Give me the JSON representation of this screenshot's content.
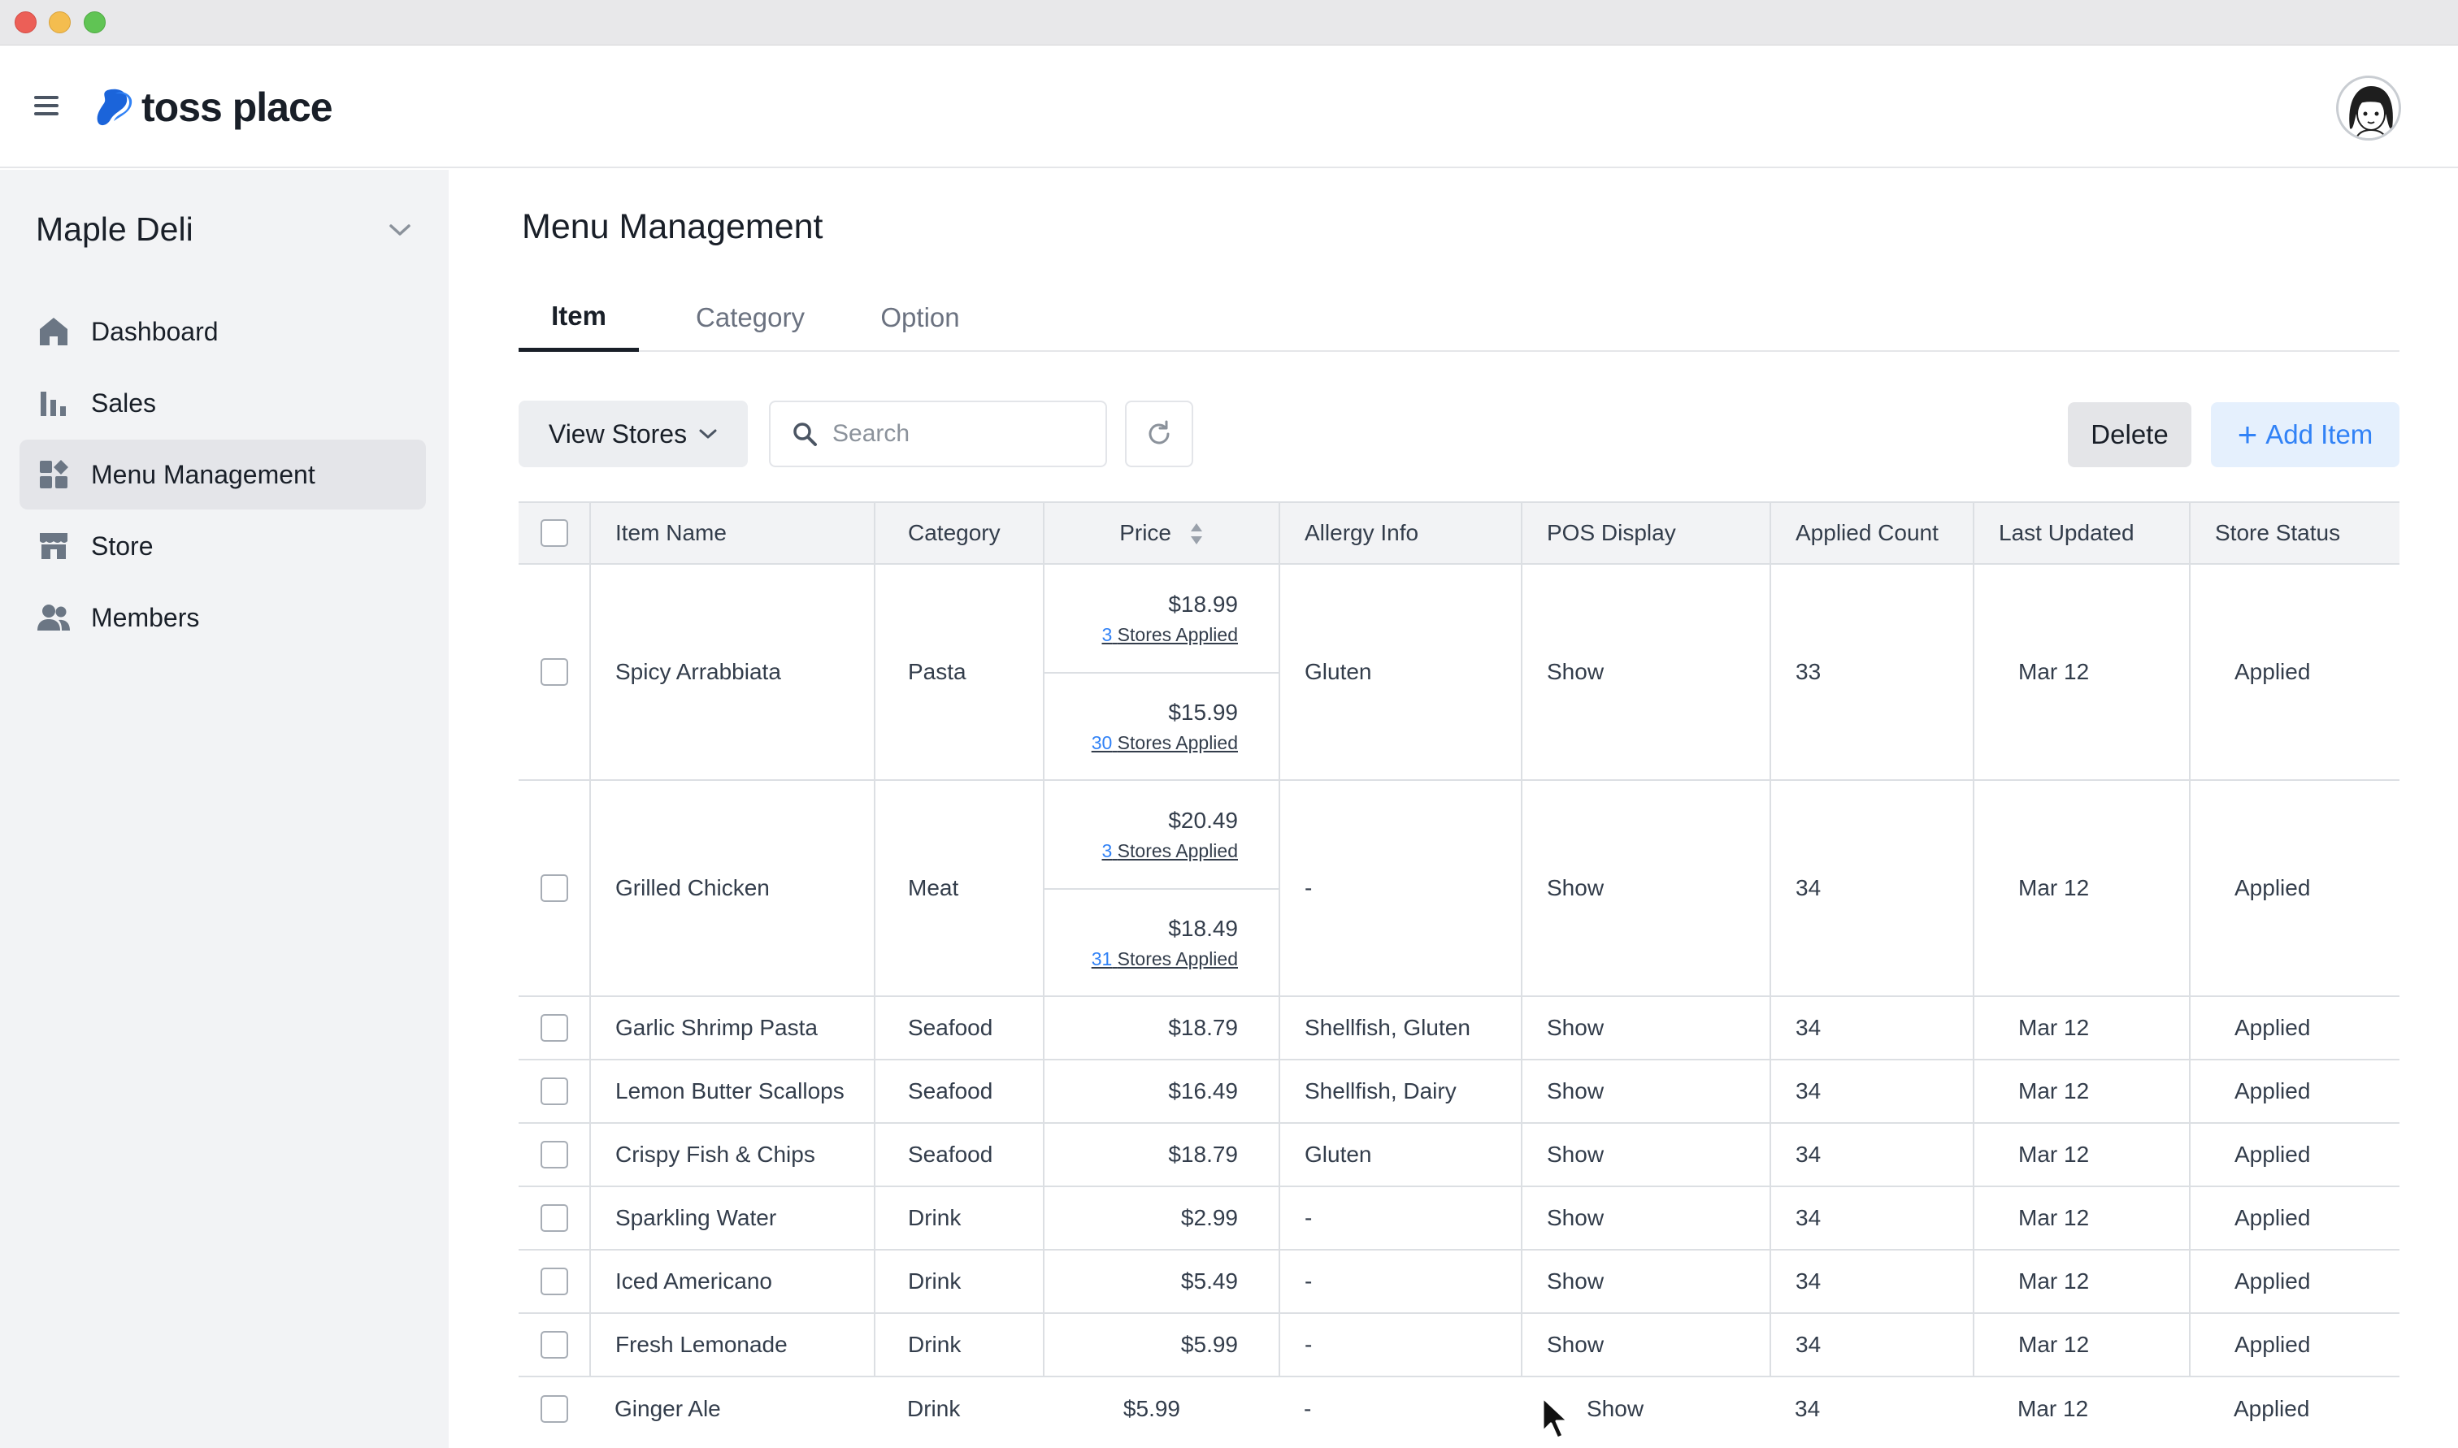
{
  "app": {
    "logo_text": "toss place",
    "brand_color": "#3182f6"
  },
  "sidebar": {
    "store_name": "Maple Deli",
    "items": [
      {
        "label": "Dashboard",
        "icon": "home-icon"
      },
      {
        "label": "Sales",
        "icon": "bar-chart-icon"
      },
      {
        "label": "Menu Management",
        "icon": "grid-icon",
        "active": true
      },
      {
        "label": "Store",
        "icon": "storefront-icon"
      },
      {
        "label": "Members",
        "icon": "people-icon"
      }
    ]
  },
  "main": {
    "title": "Menu Management",
    "tabs": [
      "Item",
      "Category",
      "Option"
    ],
    "active_tab": "Item",
    "toolbar": {
      "view_stores": "View Stores",
      "search_placeholder": "Search",
      "delete": "Delete",
      "add_item": "Add Item"
    },
    "table": {
      "columns": [
        "Item Name",
        "Category",
        "Price",
        "Allergy Info",
        "POS Display",
        "Applied Count",
        "Last Updated",
        "Store Status"
      ],
      "rows": [
        {
          "name": "Spicy Arrabbiata",
          "category": "Pasta",
          "prices": [
            {
              "value": "$18.99",
              "count": "3",
              "stores": "Stores Applied"
            },
            {
              "value": "$15.99",
              "count": "30",
              "stores": "Stores Applied"
            }
          ],
          "allergy": "Gluten",
          "pos": "Show",
          "applied": "33",
          "updated": "Mar 12",
          "status": "Applied"
        },
        {
          "name": "Grilled Chicken",
          "category": "Meat",
          "prices": [
            {
              "value": "$20.49",
              "count": "3",
              "stores": "Stores Applied"
            },
            {
              "value": "$18.49",
              "count": "31",
              "stores": "Stores Applied"
            }
          ],
          "allergy": "-",
          "pos": "Show",
          "applied": "34",
          "updated": "Mar 12",
          "status": "Applied"
        },
        {
          "name": "Garlic Shrimp Pasta",
          "category": "Seafood",
          "price": "$18.79",
          "allergy": "Shellfish, Gluten",
          "pos": "Show",
          "applied": "34",
          "updated": "Mar 12",
          "status": "Applied"
        },
        {
          "name": "Lemon Butter Scallops",
          "category": "Seafood",
          "price": "$16.49",
          "allergy": "Shellfish, Dairy",
          "pos": "Show",
          "applied": "34",
          "updated": "Mar 12",
          "status": "Applied"
        },
        {
          "name": "Crispy Fish & Chips",
          "category": "Seafood",
          "price": "$18.79",
          "allergy": "Gluten",
          "pos": "Show",
          "applied": "34",
          "updated": "Mar 12",
          "status": "Applied"
        },
        {
          "name": "Sparkling Water",
          "category": "Drink",
          "price": "$2.99",
          "allergy": "-",
          "pos": "Show",
          "applied": "34",
          "updated": "Mar 12",
          "status": "Applied"
        },
        {
          "name": "Iced Americano",
          "category": "Drink",
          "price": "$5.49",
          "allergy": "-",
          "pos": "Show",
          "applied": "34",
          "updated": "Mar 12",
          "status": "Applied"
        },
        {
          "name": "Fresh Lemonade",
          "category": "Drink",
          "price": "$5.99",
          "allergy": "-",
          "pos": "Show",
          "applied": "34",
          "updated": "Mar 12",
          "status": "Applied"
        },
        {
          "name": "Ginger Ale",
          "category": "Drink",
          "price": "$5.99",
          "allergy": "-",
          "pos": "Show",
          "applied": "34",
          "updated": "Mar 12",
          "status": "Applied"
        }
      ]
    }
  }
}
